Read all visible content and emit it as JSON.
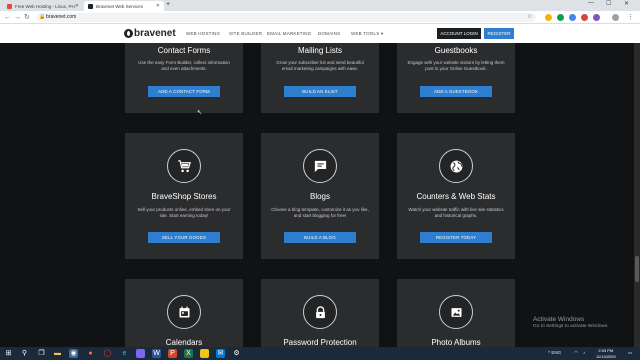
{
  "browser": {
    "tabs": [
      {
        "label": "Free Web Hosting - Linux, PHP, ...",
        "active": false,
        "favicon_color": "#e64a3c"
      },
      {
        "label": "Bravenet Web Services",
        "active": true,
        "favicon_color": "#1f2327"
      }
    ],
    "new_tab_label": "+",
    "window_controls": {
      "minimize": "—",
      "maximize": "☐",
      "close": "✕"
    },
    "address": "bravenet.com",
    "nav_icons": {
      "back": "back-arrow-icon",
      "forward": "forward-arrow-icon",
      "reload": "reload-icon"
    }
  },
  "site": {
    "logo_text": "bravenet",
    "nav": [
      "WEB HOSTING",
      "SITE BUILDER",
      "EMAIL MARKETING",
      "DOMAINS",
      "WEB TOOLS ▾"
    ],
    "login_label": "ACCOUNT LOGIN",
    "register_label": "REGISTER"
  },
  "cards": [
    {
      "title": "Contact Forms",
      "desc": "Use the easy Form Builder, collect information and even attachments.",
      "button": "ADD A CONTACT FORM",
      "icon": "envelope-icon"
    },
    {
      "title": "Mailing Lists",
      "desc": "Grow your subscriber list and send beautiful email marketing campaigns with ease.",
      "button": "BUILD AN ELIST",
      "icon": "list-icon"
    },
    {
      "title": "Guestbooks",
      "desc": "Engage with your website visitors by letting them post in your Online Guestbook.",
      "button": "ADD A GUESTBOOK",
      "icon": "book-icon"
    },
    {
      "title": "BraveShop Stores",
      "desc": "Sell your products online, embed store on your site. Start earning today!",
      "button": "SELL YOUR GOODS",
      "icon": "cart-icon"
    },
    {
      "title": "Blogs",
      "desc": "Choose a blog template, customize it as you like, and start blogging for free!",
      "button": "BUILD A BLOG",
      "icon": "chat-bubble-icon"
    },
    {
      "title": "Counters & Web Stats",
      "desc": "Watch your website traffic with live site statistics and historical graphs.",
      "button": "REGISTER TODAY",
      "icon": "globe-icon"
    },
    {
      "title": "Calendars",
      "icon": "calendar-icon"
    },
    {
      "title": "Password Protection",
      "icon": "lock-icon"
    },
    {
      "title": "Photo Albums",
      "icon": "photo-icon"
    }
  ],
  "windows_notice": {
    "title": "Activate Windows",
    "subtitle": "Go to Settings to activate Windows."
  },
  "taskbar": {
    "clock_time": "2:03 PM",
    "clock_date": "11/14/2020",
    "tray_text": "^  ENG  ",
    "start_icon": "windows-start-icon"
  },
  "colors": {
    "accent": "#2f7fd1",
    "card_bg": "#2b2c2e",
    "page_bg": "#111214"
  }
}
